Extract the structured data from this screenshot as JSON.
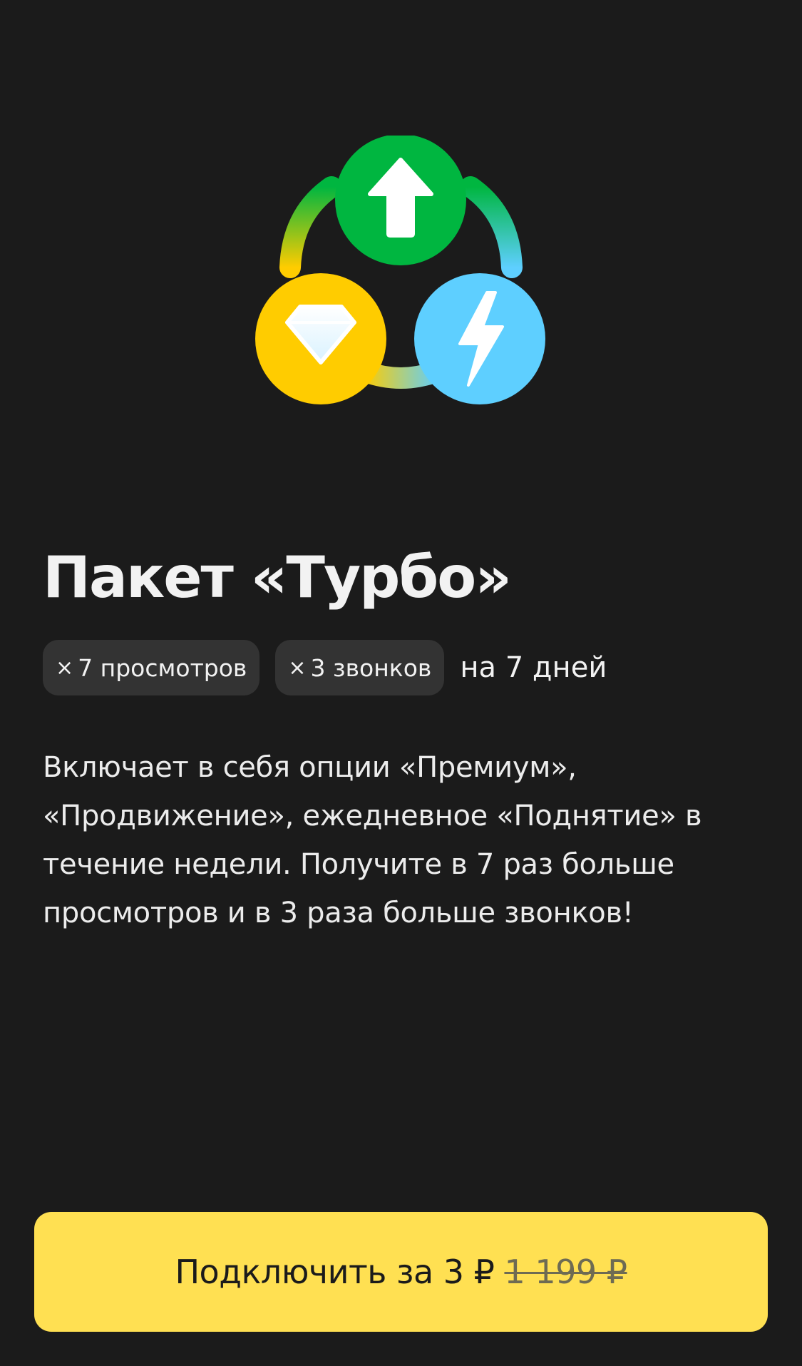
{
  "hero": {
    "icons": [
      "arrow-up-icon",
      "diamond-icon",
      "lightning-icon"
    ],
    "colors": {
      "green": "#00b640",
      "yellow": "#ffcc00",
      "blue": "#5ecfff"
    }
  },
  "package": {
    "title": "Пакет «Турбо»",
    "chips": [
      {
        "multiplier": "×",
        "text": "7 просмотров"
      },
      {
        "multiplier": "×",
        "text": "3 звонков"
      }
    ],
    "period": "на 7 дней",
    "description": "Включает в себя опции «Премиум», «Продвижение», ежедневное «Поднятие» в течение недели. Получите в 7 раз больше просмотров и в 3 раза больше звонков!"
  },
  "cta": {
    "label": "Подключить за 3 ₽",
    "old_price": "1 199 ₽",
    "color": "#ffe052"
  }
}
